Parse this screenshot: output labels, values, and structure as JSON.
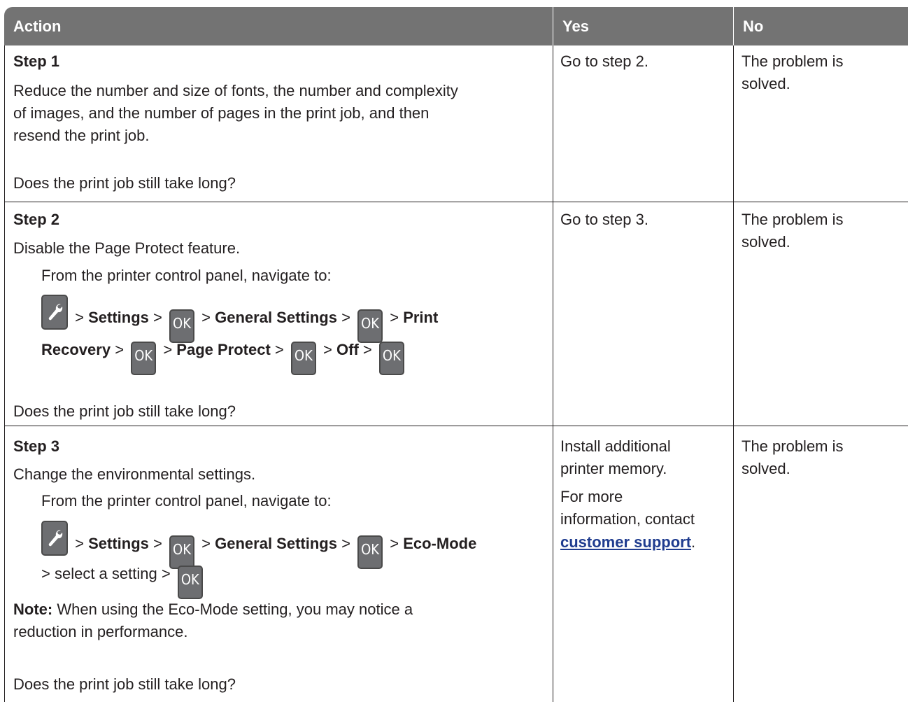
{
  "headers": {
    "action": "Action",
    "yes": "Yes",
    "no": "No"
  },
  "common": {
    "navigate_intro": "From the printer control panel, navigate to:",
    "question": "Does the print job still take long?",
    "ok_key": "OK",
    "gt": ">",
    "settings": "Settings",
    "general_settings": "General Settings",
    "problem_solved_line1": "The problem is",
    "problem_solved_line2": "solved."
  },
  "step1": {
    "title": "Step 1",
    "body_lines": [
      "Reduce the number and size of fonts, the number and complexity",
      "of images, and the number of pages in the print job, and then",
      "resend the print job."
    ],
    "yes": "Go to step 2."
  },
  "step2": {
    "title": "Step 2",
    "instruction": "Disable the Page Protect feature.",
    "print": "Print",
    "recovery": "Recovery",
    "page_protect": "Page Protect",
    "off": "Off",
    "yes": "Go to step 3."
  },
  "step3": {
    "title": "Step 3",
    "instruction": "Change the environmental settings.",
    "eco_mode": "Eco-Mode",
    "select_setting": "> select a setting >",
    "note_label": "Note:",
    "note_line1": "When using the Eco-Mode setting, you may notice a",
    "note_line2": "reduction in performance.",
    "yes_line1": "Install additional",
    "yes_line2": "printer memory.",
    "yes_line3": "For more",
    "yes_line4": "information, contact",
    "support_link": "customer support",
    "period": "."
  },
  "icons": {
    "settings_key": "wrench-icon",
    "ok_key": "ok-key-icon"
  },
  "colors": {
    "header_bg": "#737373",
    "link": "#1f3c8f",
    "key_bg": "#6d6e71"
  }
}
